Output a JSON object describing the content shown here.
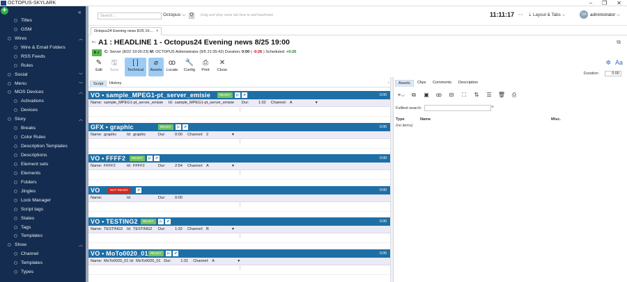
{
  "window": {
    "title": "OCTOPUS-SKYLARK",
    "app_icon_text": "51",
    "controls": [
      "–",
      "❐",
      "✕"
    ]
  },
  "sidebar": {
    "items": [
      {
        "label": "Titles",
        "level": "sub"
      },
      {
        "label": "GSM",
        "level": "sub"
      },
      {
        "label": "Wires",
        "level": "section",
        "expanded": true
      },
      {
        "label": "Wire & Email Folders",
        "level": "sub"
      },
      {
        "label": "RSS Feeds",
        "level": "sub"
      },
      {
        "label": "Rules",
        "level": "sub"
      },
      {
        "label": "Social",
        "level": "section",
        "expanded": false
      },
      {
        "label": "Menu",
        "level": "section",
        "expanded": false
      },
      {
        "label": "MOS Devices",
        "level": "section",
        "expanded": true
      },
      {
        "label": "Activations",
        "level": "sub"
      },
      {
        "label": "Devices",
        "level": "sub"
      },
      {
        "label": "Story",
        "level": "section",
        "expanded": true
      },
      {
        "label": "Breaks",
        "level": "sub"
      },
      {
        "label": "Color Rules",
        "level": "sub"
      },
      {
        "label": "Description Templates",
        "level": "sub"
      },
      {
        "label": "Descriptions",
        "level": "sub"
      },
      {
        "label": "Element sets",
        "level": "sub"
      },
      {
        "label": "Elements",
        "level": "sub"
      },
      {
        "label": "Folders",
        "level": "sub"
      },
      {
        "label": "Jingles",
        "level": "sub"
      },
      {
        "label": "Lock Manager",
        "level": "sub"
      },
      {
        "label": "Script tags",
        "level": "sub"
      },
      {
        "label": "States",
        "level": "sub"
      },
      {
        "label": "Tags",
        "level": "sub"
      },
      {
        "label": "Templates",
        "level": "sub"
      },
      {
        "label": "Show",
        "level": "section",
        "expanded": true
      },
      {
        "label": "Channel",
        "level": "sub"
      },
      {
        "label": "Templates",
        "level": "sub"
      },
      {
        "label": "Types",
        "level": "sub"
      }
    ]
  },
  "topbar": {
    "search_placeholder": "Search...",
    "search_scope": "Octopus ⌵",
    "search_button": "Q",
    "bookmark_hint": "Drag and drop some tab here to add bookmark",
    "clock": "11:11:17",
    "layout_tabs": "Layout & Tabs ⌵",
    "avatar_initials": "OA",
    "user": "administrator ⌵"
  },
  "doc_tab": {
    "label": "Octopus24 Evening news 8/25 19:...",
    "close": "×"
  },
  "doc": {
    "back": "←",
    "headline": "A1 : HEADLINE 1 - Octopus24 Evening news 8/25 19:00",
    "status_badge": "A ✓",
    "status": {
      "c_label": "C:",
      "c_text": " Server (8/22 19:00:23) ",
      "m_label": "M:",
      "m_text": " OCTOPUS Administrator (9/5 21:35:42) Duration: ",
      "duration": "0:00",
      "paren_open": " ( ",
      "diff": "-0:26",
      "paren_close": " ) Scheduled: ",
      "scheduled": "+0:20"
    }
  },
  "toolbar": {
    "buttons": [
      {
        "label": "Edit",
        "icon": "✎",
        "state": "normal"
      },
      {
        "label": "Save",
        "icon": "🖫",
        "state": "disabled"
      },
      {
        "label": "Technical",
        "icon": "[ ]",
        "state": "active"
      },
      {
        "label": "Assets",
        "icon": "⌀",
        "state": "active"
      },
      {
        "label": "Locate",
        "icon": "ꝏ",
        "state": "normal"
      },
      {
        "label": "Config",
        "icon": "🔧",
        "state": "normal"
      },
      {
        "label": "Print",
        "icon": "⎙",
        "state": "normal"
      },
      {
        "label": "Close",
        "icon": "✕",
        "state": "normal"
      }
    ],
    "duration_label": "Duration:",
    "duration_value": "0:00"
  },
  "left_tabs": [
    "Script",
    "History"
  ],
  "right_panel": {
    "tabs": [
      "Assets",
      "Clips",
      "Comments",
      "Description"
    ],
    "fulltext_label": "Fulltext search:",
    "clear": "×",
    "columns": [
      "Type",
      "Name",
      "Misc."
    ],
    "empty_text": "(no items)"
  },
  "script_cards": [
    {
      "title": "VO • sample_MPEG1-pt_server_emisie",
      "status": "READY",
      "status_kind": "ready",
      "time": "0:00",
      "name": "sample_MPEG1-pt_server_emisie",
      "id": "sample_MPEG1-pt_server_emisie",
      "dur": "1:32",
      "channel": "A"
    },
    {
      "title": "GFX • graphic",
      "status": "READY",
      "status_kind": "ready",
      "time": "0:00",
      "name": "graphic",
      "id": "graphic",
      "dur": "0:00",
      "channel": "2"
    },
    {
      "title": "VO • FFFF2",
      "status": "READY",
      "status_kind": "ready",
      "time": "0:00",
      "name": "FFFF2",
      "id": "FFFF2",
      "dur": "2:54",
      "channel": "A"
    },
    {
      "title": "VO",
      "status": "NOT READY",
      "status_kind": "notready",
      "time": "0:00",
      "name": "",
      "id": "",
      "dur": "0:00",
      "channel": ""
    },
    {
      "title": "VO • TESTING2",
      "status": "READY",
      "status_kind": "ready",
      "time": "0:00",
      "name": "TESTING2",
      "id": "TESTING2",
      "dur": "1:32",
      "channel": "B"
    },
    {
      "title": "VO • MoTo0020_01",
      "status": "READY",
      "status_kind": "ready",
      "time": "0:00",
      "name": "MoTo0020_01",
      "id": "MoTo0020_01",
      "dur": "1:31",
      "channel": "A"
    }
  ],
  "labels": {
    "name": "Name:",
    "id": "Id:",
    "dur": "Dur:",
    "channel": "Channel:",
    "handle": "⋮"
  },
  "colors": {
    "sidebar_bg": "#142c4f",
    "card_header": "#1e6fa6",
    "ready": "#72c35d",
    "not_ready": "#d9261c",
    "add_button": "#25b04a"
  }
}
